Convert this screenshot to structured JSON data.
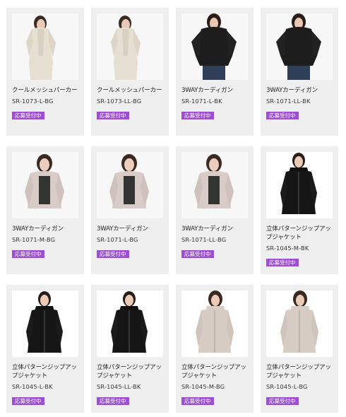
{
  "badge_label": "応募受付中",
  "products": [
    {
      "name": "クールメッシュパーカー",
      "code": "SR-1073-L-BG",
      "figure": "hoodie"
    },
    {
      "name": "クールメッシュパーカー",
      "code": "SR-1073-LL-BG",
      "figure": "hoodie"
    },
    {
      "name": "3WAYカーディガン",
      "code": "SR-1071-L-BK",
      "figure": "cardigan-black"
    },
    {
      "name": "3WAYカーディガン",
      "code": "SR-1071-LL-BK",
      "figure": "cardigan-black"
    },
    {
      "name": "3WAYカーディガン",
      "code": "SR-1071-M-BG",
      "figure": "cardigan-beige"
    },
    {
      "name": "3WAYカーディガン",
      "code": "SR-1071-L-BG",
      "figure": "cardigan-beige"
    },
    {
      "name": "3WAYカーディガン",
      "code": "SR-1071-LL-BG",
      "figure": "cardigan-beige"
    },
    {
      "name": "立体パターンジップアップジャケット",
      "code": "SR-1045-M-BK",
      "figure": "jacket-black"
    },
    {
      "name": "立体パターンジップアップジャケット",
      "code": "SR-1045-L-BK",
      "figure": "jacket-black"
    },
    {
      "name": "立体パターンジップアップジャケット",
      "code": "SR-1045-LL-BK",
      "figure": "jacket-black"
    },
    {
      "name": "立体パターンジップアップジャケット",
      "code": "SR-1045-M-BG",
      "figure": "jacket-beige"
    },
    {
      "name": "立体パターンジップアップジャケット",
      "code": "SR-1045-L-BG",
      "figure": "jacket-beige"
    }
  ],
  "colors": {
    "badge": "#9d4fd0",
    "card": "#efefef"
  }
}
